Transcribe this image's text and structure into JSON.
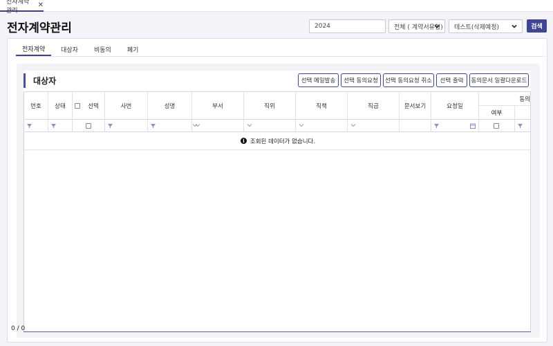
{
  "tab": {
    "label": "전자계약관리",
    "close": "✕"
  },
  "header": {
    "title": "전자계약관리",
    "year_value": "2024",
    "type_select": "전체 ( 계약서유형)",
    "test_select": "테스트(삭제예정)",
    "search_label": "검색"
  },
  "subtabs": [
    "전자계약",
    "대상자",
    "비동의",
    "폐기"
  ],
  "section": {
    "title": "대상자",
    "buttons": [
      "선택 메일발송",
      "선택 동의요청",
      "선택 동의요청 취소",
      "선택 출력",
      "동의문서 일괄다운로드"
    ]
  },
  "grid": {
    "columns": [
      "번호",
      "상태",
      "선택",
      "사번",
      "성명",
      "부서",
      "직위",
      "직책",
      "직급",
      "문서보기",
      "요청일"
    ],
    "group_header": "동의",
    "group_sub": "여부",
    "empty_message": "조회된 데이터가 없습니다."
  },
  "footer": {
    "count": "0 / 0"
  },
  "colors": {
    "accent": "#3f4591",
    "funnel": "#8a8fc4"
  }
}
